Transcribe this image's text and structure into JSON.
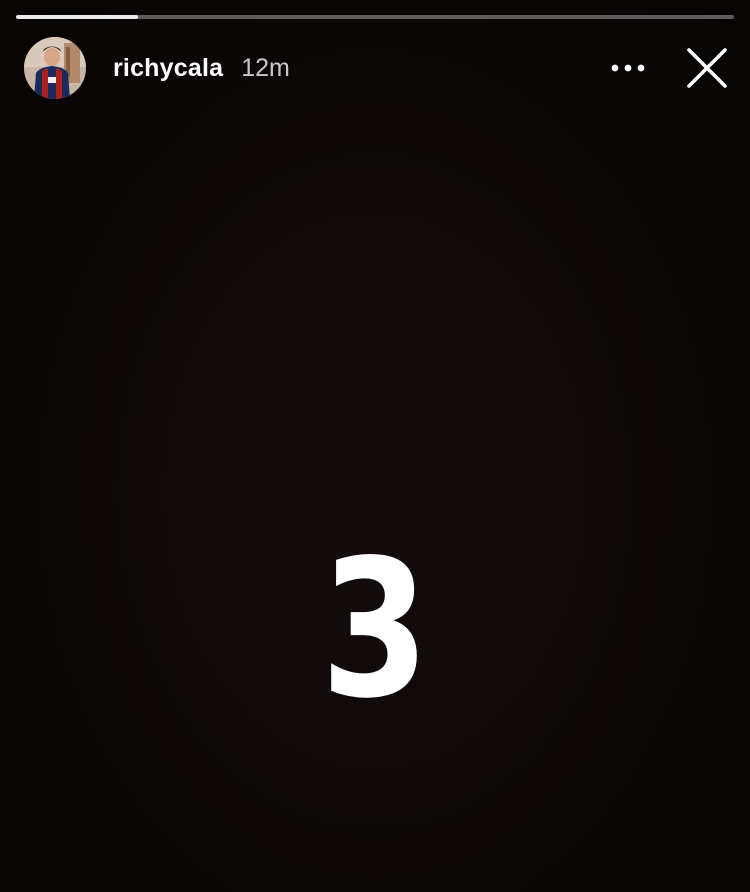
{
  "story": {
    "progress_fraction": 0.17,
    "username": "richycala",
    "timestamp": "12m",
    "content_text": "3"
  },
  "icons": {
    "avatar": "profile-photo",
    "more": "more-horizontal-icon",
    "close": "close-icon"
  },
  "colors": {
    "background": "#0b0707",
    "text": "#ffffff",
    "progress_track": "#ffffff59",
    "progress_fill": "#e9e9e9"
  }
}
